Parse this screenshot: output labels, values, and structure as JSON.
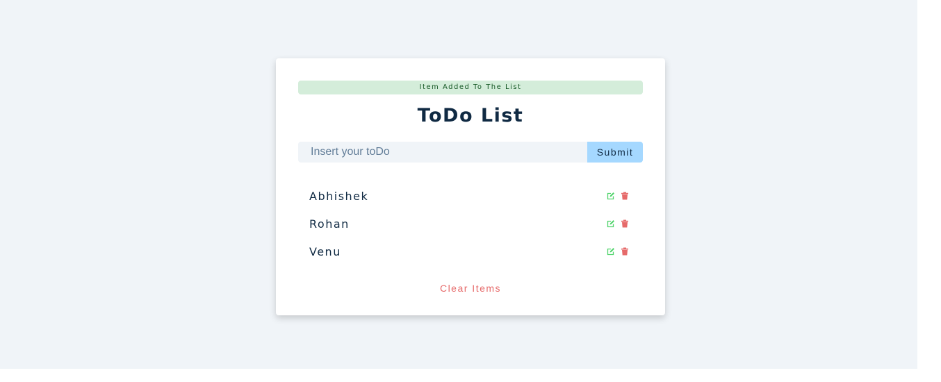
{
  "alert": {
    "text": "Item Added To The List",
    "color": "#155724",
    "background": "#d4edda"
  },
  "title": "ToDo List",
  "form": {
    "placeholder": "Insert your toDo",
    "value": "",
    "submit_label": "Submit"
  },
  "items": [
    {
      "title": "Abhishek",
      "edit_icon": "edit-icon",
      "delete_icon": "trash-icon"
    },
    {
      "title": "Rohan",
      "edit_icon": "edit-icon",
      "delete_icon": "trash-icon"
    },
    {
      "title": "Venu",
      "edit_icon": "edit-icon",
      "delete_icon": "trash-icon"
    }
  ],
  "clear_label": "Clear Items",
  "colors": {
    "page_background": "#f0f4f8",
    "title": "#102a43",
    "submit_button": "#a5d8ff",
    "edit_icon": "#50d46c",
    "delete_icon": "#e66a6a",
    "clear_text": "#e66a6a"
  }
}
